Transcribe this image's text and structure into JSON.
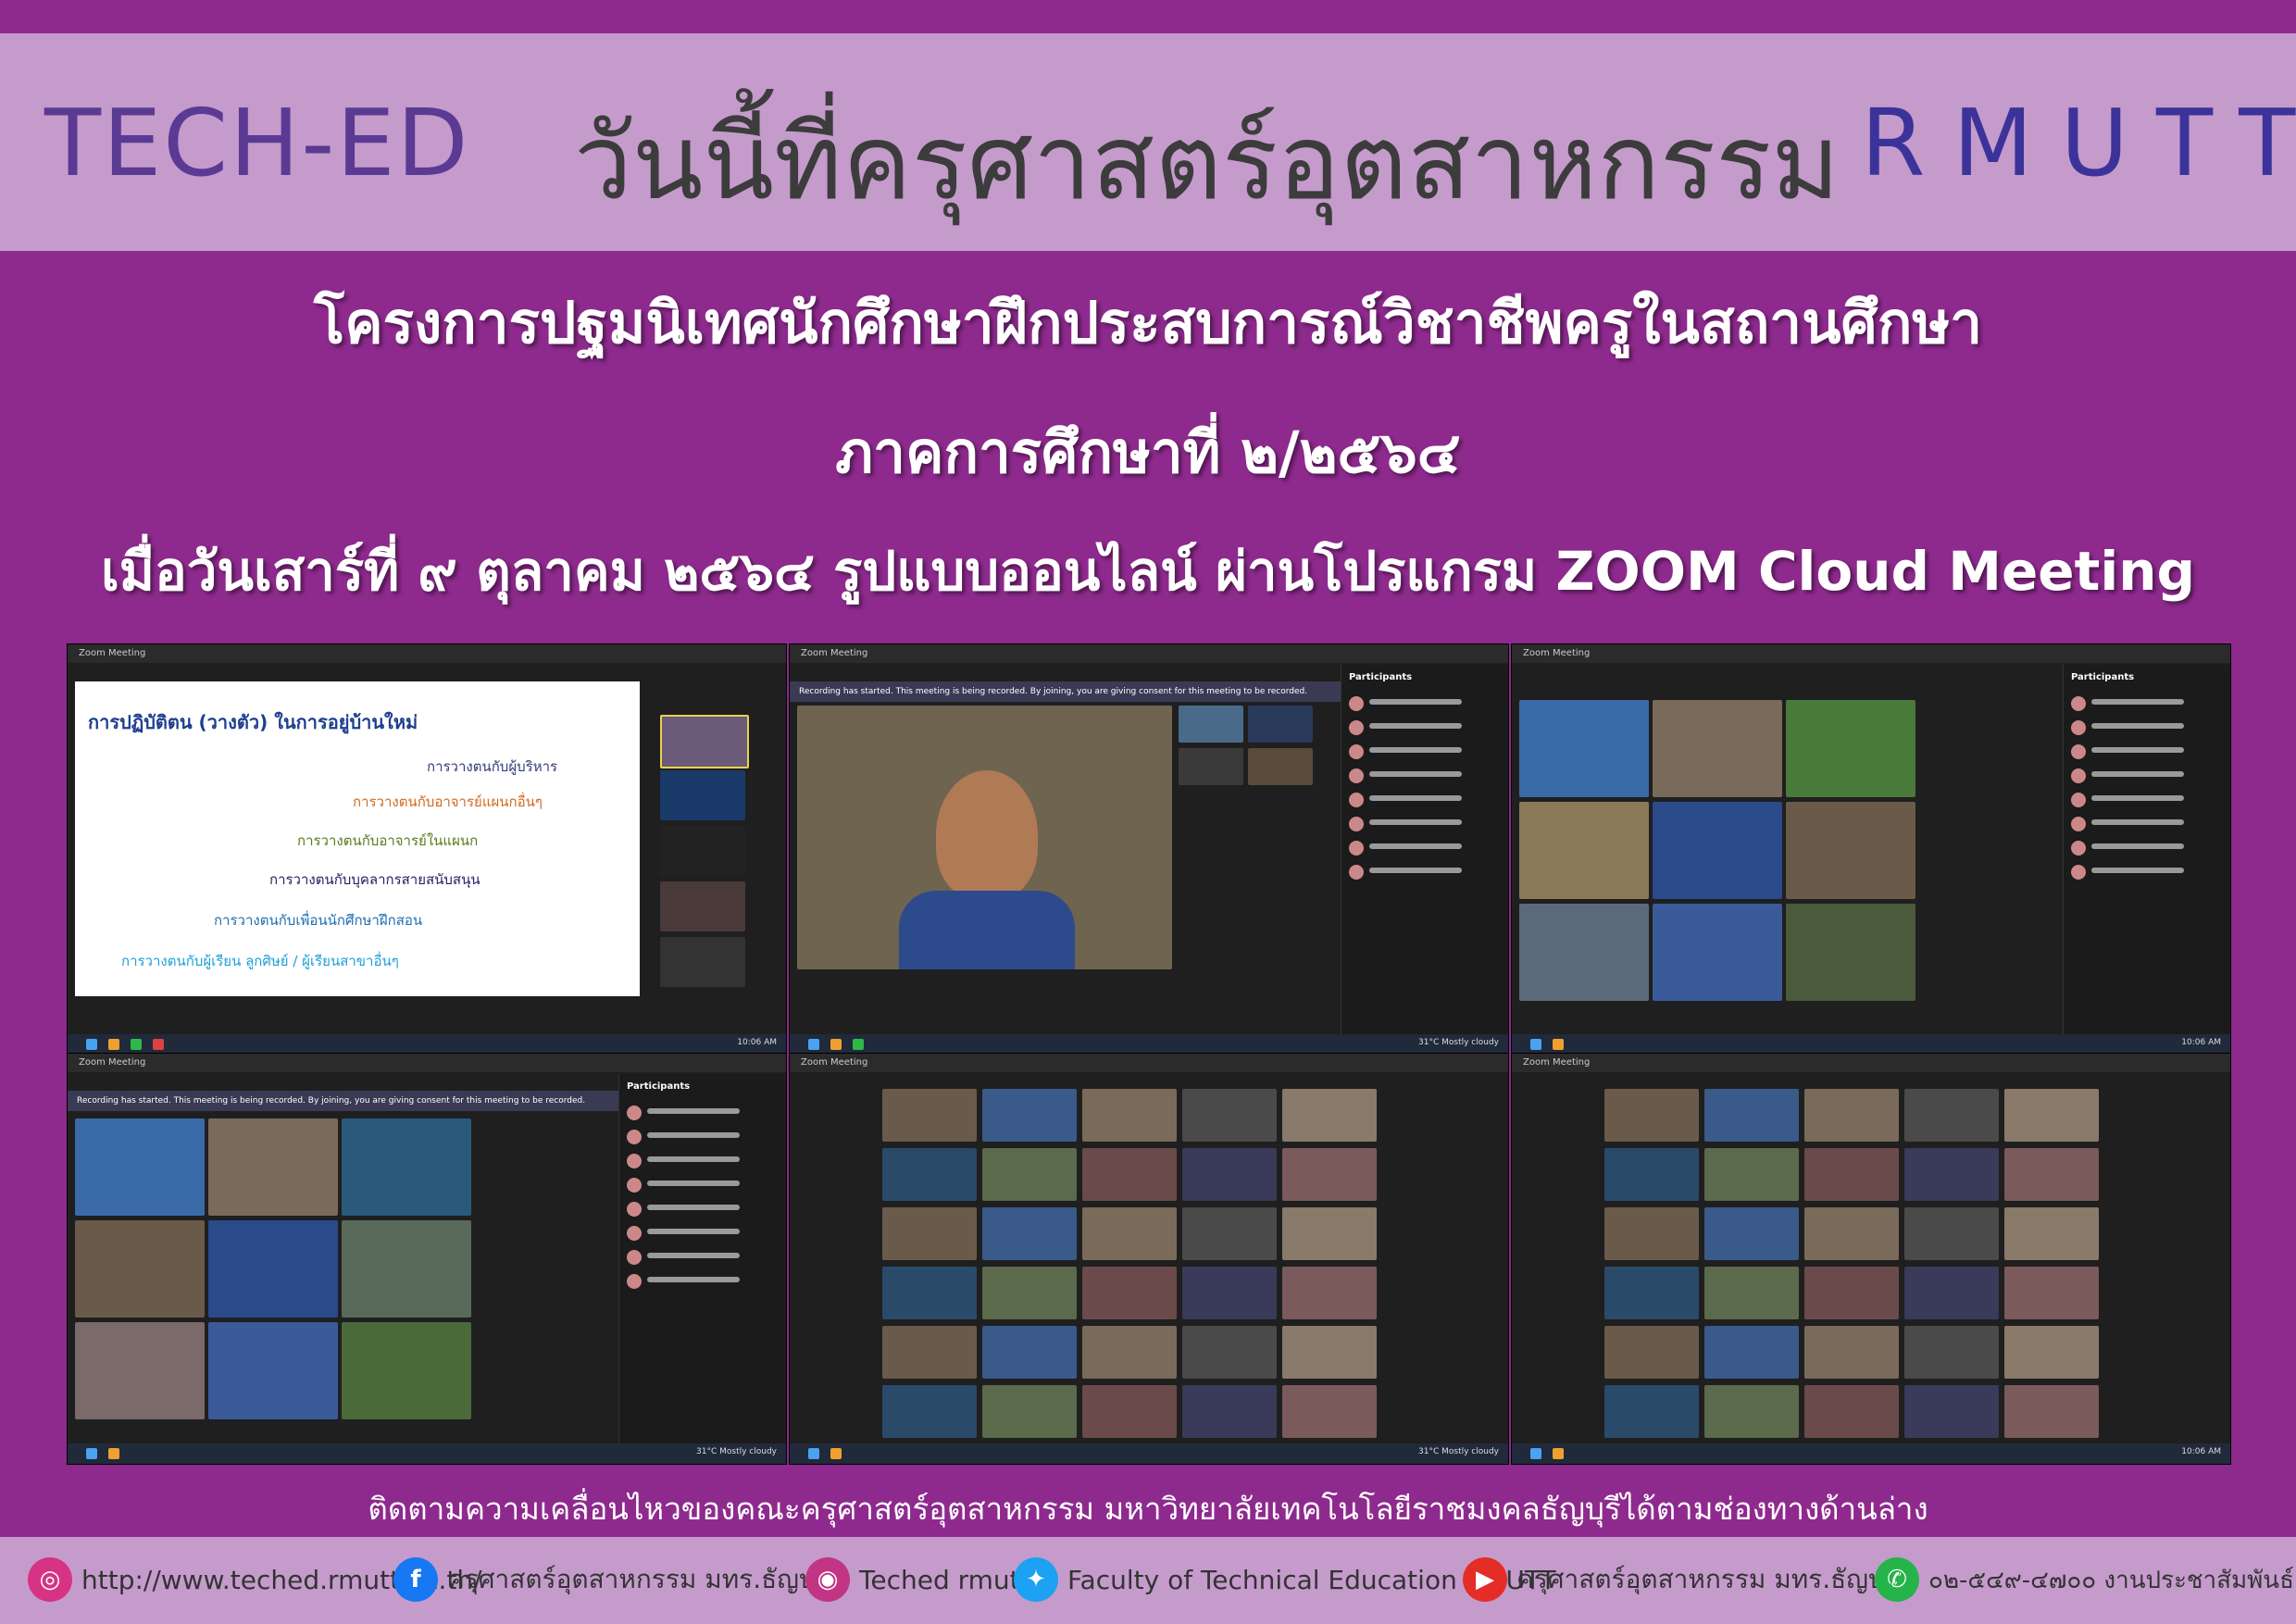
{
  "header": {
    "left": "TECH-ED",
    "center": "วันนี้ที่ครุศาสตร์อุตสาหกรรม",
    "right": "RMUTT"
  },
  "titles": {
    "line1": "โครงการปฐมนิเทศนักศึกษาฝึกประสบการณ์วิชาชีพครูในสถานศึกษา",
    "line2": "ภาคการศึกษาที่ ๒/๒๕๖๔",
    "line3": "เมื่อวันเสาร์ที่ ๙ ตุลาคม ๒๕๖๔ รูปแบบออนไลน์ ผ่านโปรแกรม ZOOM Cloud Meeting"
  },
  "slide": {
    "title": "การปฏิบัติตน (วางตัว) ในการอยู่บ้านใหม่",
    "lines": [
      "การวางตนกับผู้บริหาร",
      "การวางตนกับอาจารย์แผนกอื่นๆ",
      "การวางตนกับอาจารย์ในแผนก",
      "การวางตนกับบุคลากรสายสนับสนุน",
      "การวางตนกับเพื่อนนักศึกษาฝึกสอน",
      "การวางตนกับผู้เรียน ลูกศิษย์ / ผู้เรียนสาขาอื่นๆ"
    ]
  },
  "zoom": {
    "window_title": "Zoom Meeting",
    "recording_banner": "Recording has started. This meeting is being recorded. By joining, you are giving consent for this meeting to be recorded.",
    "participants_label": "Participants",
    "time": "10:06 AM",
    "weather": "31°C Mostly cloudy"
  },
  "follow_text": "ติดตามความเคลื่อนไหวของคณะครุศาสตร์อุตสาหกรรม มหาวิทยาลัยเทคโนโลยีราชมงคลธัญบุรีได้ตามช่องทางด้านล่าง",
  "footer": [
    {
      "icon": "globe-icon",
      "glyph": "◎",
      "color": "#d63384",
      "text": "http://www.teched.rmutt.ac.th/"
    },
    {
      "icon": "facebook-icon",
      "glyph": "f",
      "color": "#1877f2",
      "text": "ครุศาสตร์อุตสาหกรรม มทร.ธัญบุรี"
    },
    {
      "icon": "instagram-icon",
      "glyph": "◉",
      "color": "#c13584",
      "text": "Teched rmutt"
    },
    {
      "icon": "twitter-icon",
      "glyph": "✦",
      "color": "#1da1f2",
      "text": "Faculty of Technical Education RMUTT"
    },
    {
      "icon": "youtube-icon",
      "glyph": "▶",
      "color": "#e52d27",
      "text": "ครุศาสตร์อุตสาหกรรม มทร.ธัญบุรี"
    },
    {
      "icon": "whatsapp-icon",
      "glyph": "✆",
      "color": "#25b34a",
      "text": "๐๒-๕๔๙-๔๗๐๐ งานประชาสัมพันธ์"
    }
  ]
}
